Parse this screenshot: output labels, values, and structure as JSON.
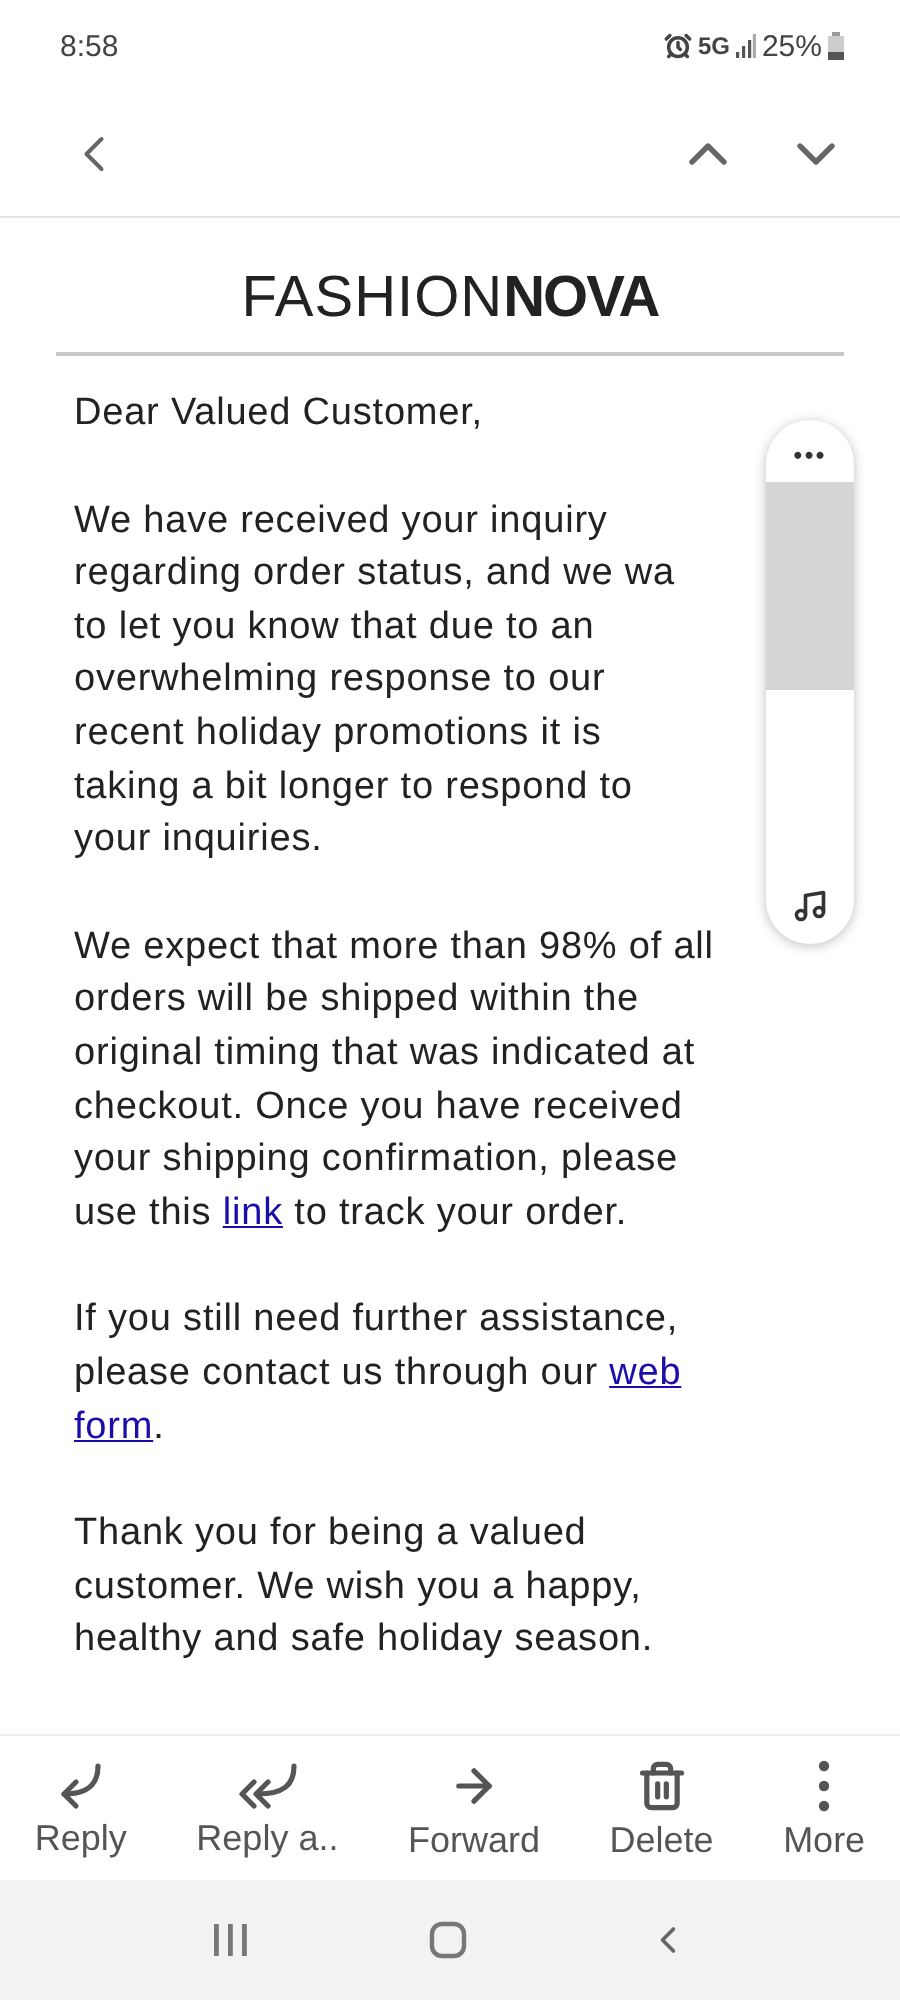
{
  "status_bar": {
    "time": "8:58",
    "network": "5G",
    "battery": "25%"
  },
  "logo": "FASHION**NOVA**",
  "paragraphs": [
    [
      {
        "text": "Dear Valued Customer,"
      }
    ],
    [
      {
        "text": "We have received your inquiry\nregarding order status, and we wa\nto let you know that due to an\noverwhelming response to our\nrecent holiday promotions it is\ntaking a bit longer to respond to\nyour inquiries."
      }
    ],
    [
      {
        "text": "We expect that more than 98% of all\norders will be shipped within the\noriginal timing that was indicated at\ncheckout. Once you have received\nyour shipping confirmation, please\nuse this "
      },
      {
        "text": "link",
        "kind": "link"
      },
      {
        "text": " to track your order."
      }
    ],
    [
      {
        "text": "If you still need further assistance,\nplease contact us through our "
      },
      {
        "text": "web",
        "kind": "link"
      },
      {
        "kind": "break"
      },
      {
        "text": "form",
        "kind": "link"
      },
      {
        "text": "."
      }
    ],
    [
      {
        "text": "Thank you for being a valued\ncustomer. We wish you a happy,\nhealthy and safe holiday season."
      }
    ]
  ],
  "volume_panel": {
    "menu": "•••",
    "level": 0.55
  },
  "toolbar": [
    {
      "kind": "reply",
      "label": "Reply"
    },
    {
      "kind": "reply_all",
      "label": "Reply a.."
    },
    {
      "kind": "forward",
      "label": "Forward"
    },
    {
      "kind": "delete",
      "label": "Delete"
    },
    {
      "kind": "more",
      "label": "More"
    }
  ]
}
